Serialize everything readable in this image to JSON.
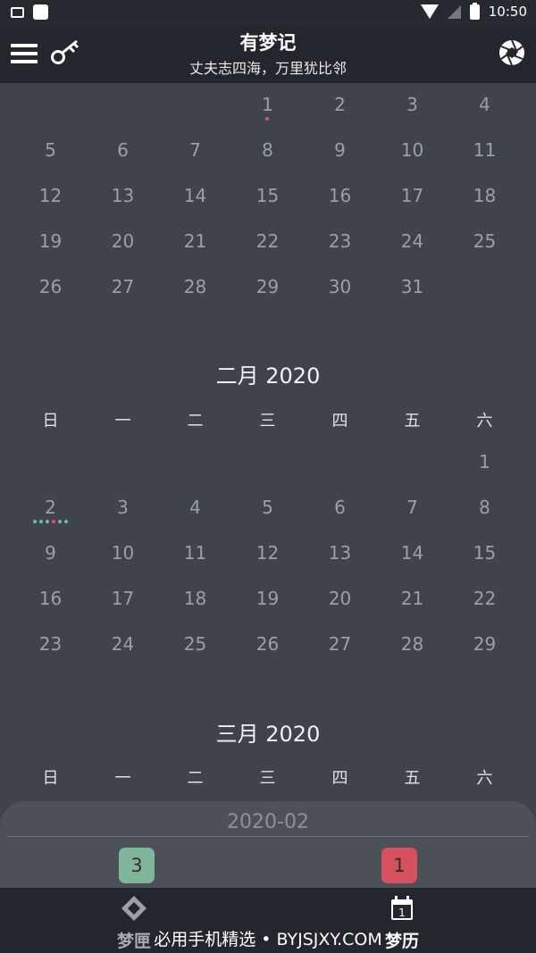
{
  "status_bar": {
    "time": "10:50",
    "icons": [
      "image-icon",
      "square-icon",
      "wifi-icon",
      "signal-icon",
      "battery-icon"
    ]
  },
  "app_bar": {
    "title": "有梦记",
    "subtitle": "丈夫志四海，万里犹比邻"
  },
  "colors": {
    "dot_red": "#e25555",
    "dot_teal": "#6fbea0",
    "badge_green": "#7fb59a",
    "badge_red": "#d6505e"
  },
  "weekdays": [
    "日",
    "一",
    "二",
    "三",
    "四",
    "五",
    "六"
  ],
  "months": [
    {
      "title": "",
      "first_weekday": 3,
      "days": 31,
      "marked": {
        "1": [
          "#e25555"
        ]
      }
    },
    {
      "title": "二月 2020",
      "first_weekday": 6,
      "days": 29,
      "marked": {
        "2": [
          "#6fbea0",
          "#6fbea0",
          "#6fbea0",
          "#e25555",
          "#6fbea0",
          "#6fbea0"
        ]
      }
    },
    {
      "title": "三月 2020",
      "first_weekday": 0,
      "days": 0,
      "marked": {}
    }
  ],
  "bottom_panel": {
    "month": "2020-02",
    "left_count": "3",
    "right_count": "1"
  },
  "bottom_nav": {
    "left_label": "梦匣",
    "right_label": "梦历",
    "calendar_day": "1"
  },
  "watermark": "必用手机精选 • BYJSJXY.COM"
}
